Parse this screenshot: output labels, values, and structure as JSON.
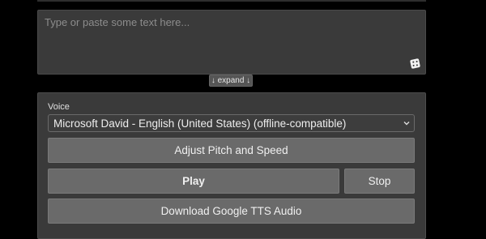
{
  "text_input": {
    "placeholder": "Type or paste some text here...",
    "value": ""
  },
  "expand_label": "↓ expand ↓",
  "voice": {
    "label": "Voice",
    "selected": "Microsoft David - English (United States) (offline-compatible)"
  },
  "buttons": {
    "pitch_speed": "Adjust Pitch and Speed",
    "play": "Play",
    "stop": "Stop",
    "download": "Download Google TTS Audio"
  },
  "icons": {
    "dice": "dice-icon",
    "dropdown": "chevron-down-icon"
  },
  "colors": {
    "background": "#000000",
    "panel": "#3a3a3a",
    "button": "#6a6a6a"
  }
}
